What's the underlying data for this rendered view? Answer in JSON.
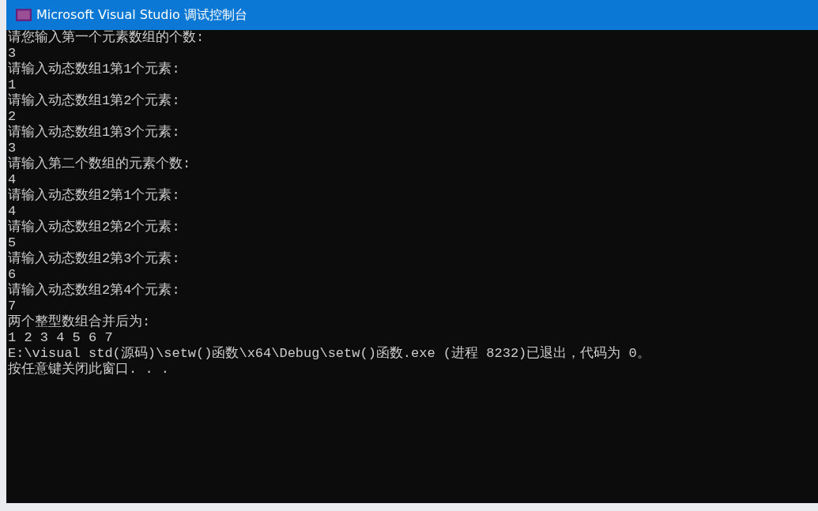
{
  "window": {
    "title": "Microsoft Visual Studio 调试控制台"
  },
  "console": {
    "lines": [
      "请您输入第一个元素数组的个数:",
      "3",
      "请输入动态数组1第1个元素:",
      "1",
      "请输入动态数组1第2个元素:",
      "2",
      "请输入动态数组1第3个元素:",
      "3",
      "请输入第二个数组的元素个数:",
      "4",
      "请输入动态数组2第1个元素:",
      "4",
      "请输入动态数组2第2个元素:",
      "5",
      "请输入动态数组2第3个元素:",
      "6",
      "请输入动态数组2第4个元素:",
      "7",
      "两个整型数组合并后为:",
      "1 2 3 4 5 6 7",
      "E:\\visual std(源码)\\setw()函数\\x64\\Debug\\setw()函数.exe (进程 8232)已退出，代码为 0。",
      "按任意键关闭此窗口. . ."
    ]
  }
}
